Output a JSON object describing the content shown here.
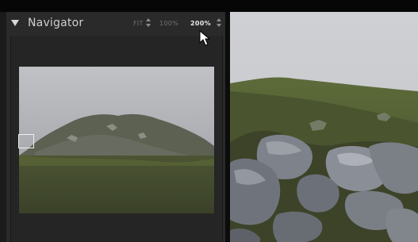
{
  "navigator": {
    "title": "Navigator",
    "zoom_options": [
      {
        "label": "FIT",
        "active": false
      },
      {
        "label": "100%",
        "active": false
      },
      {
        "label": "200%",
        "active": true
      }
    ]
  },
  "icons": {
    "collapse": "triangle-down-icon",
    "stepper": "up-down-arrows-icon",
    "cursor": "mouse-pointer-icon"
  },
  "colors": {
    "panel_bg": "#2a2a2a",
    "active_text": "#e8e8e8",
    "inactive_text": "#707070"
  }
}
